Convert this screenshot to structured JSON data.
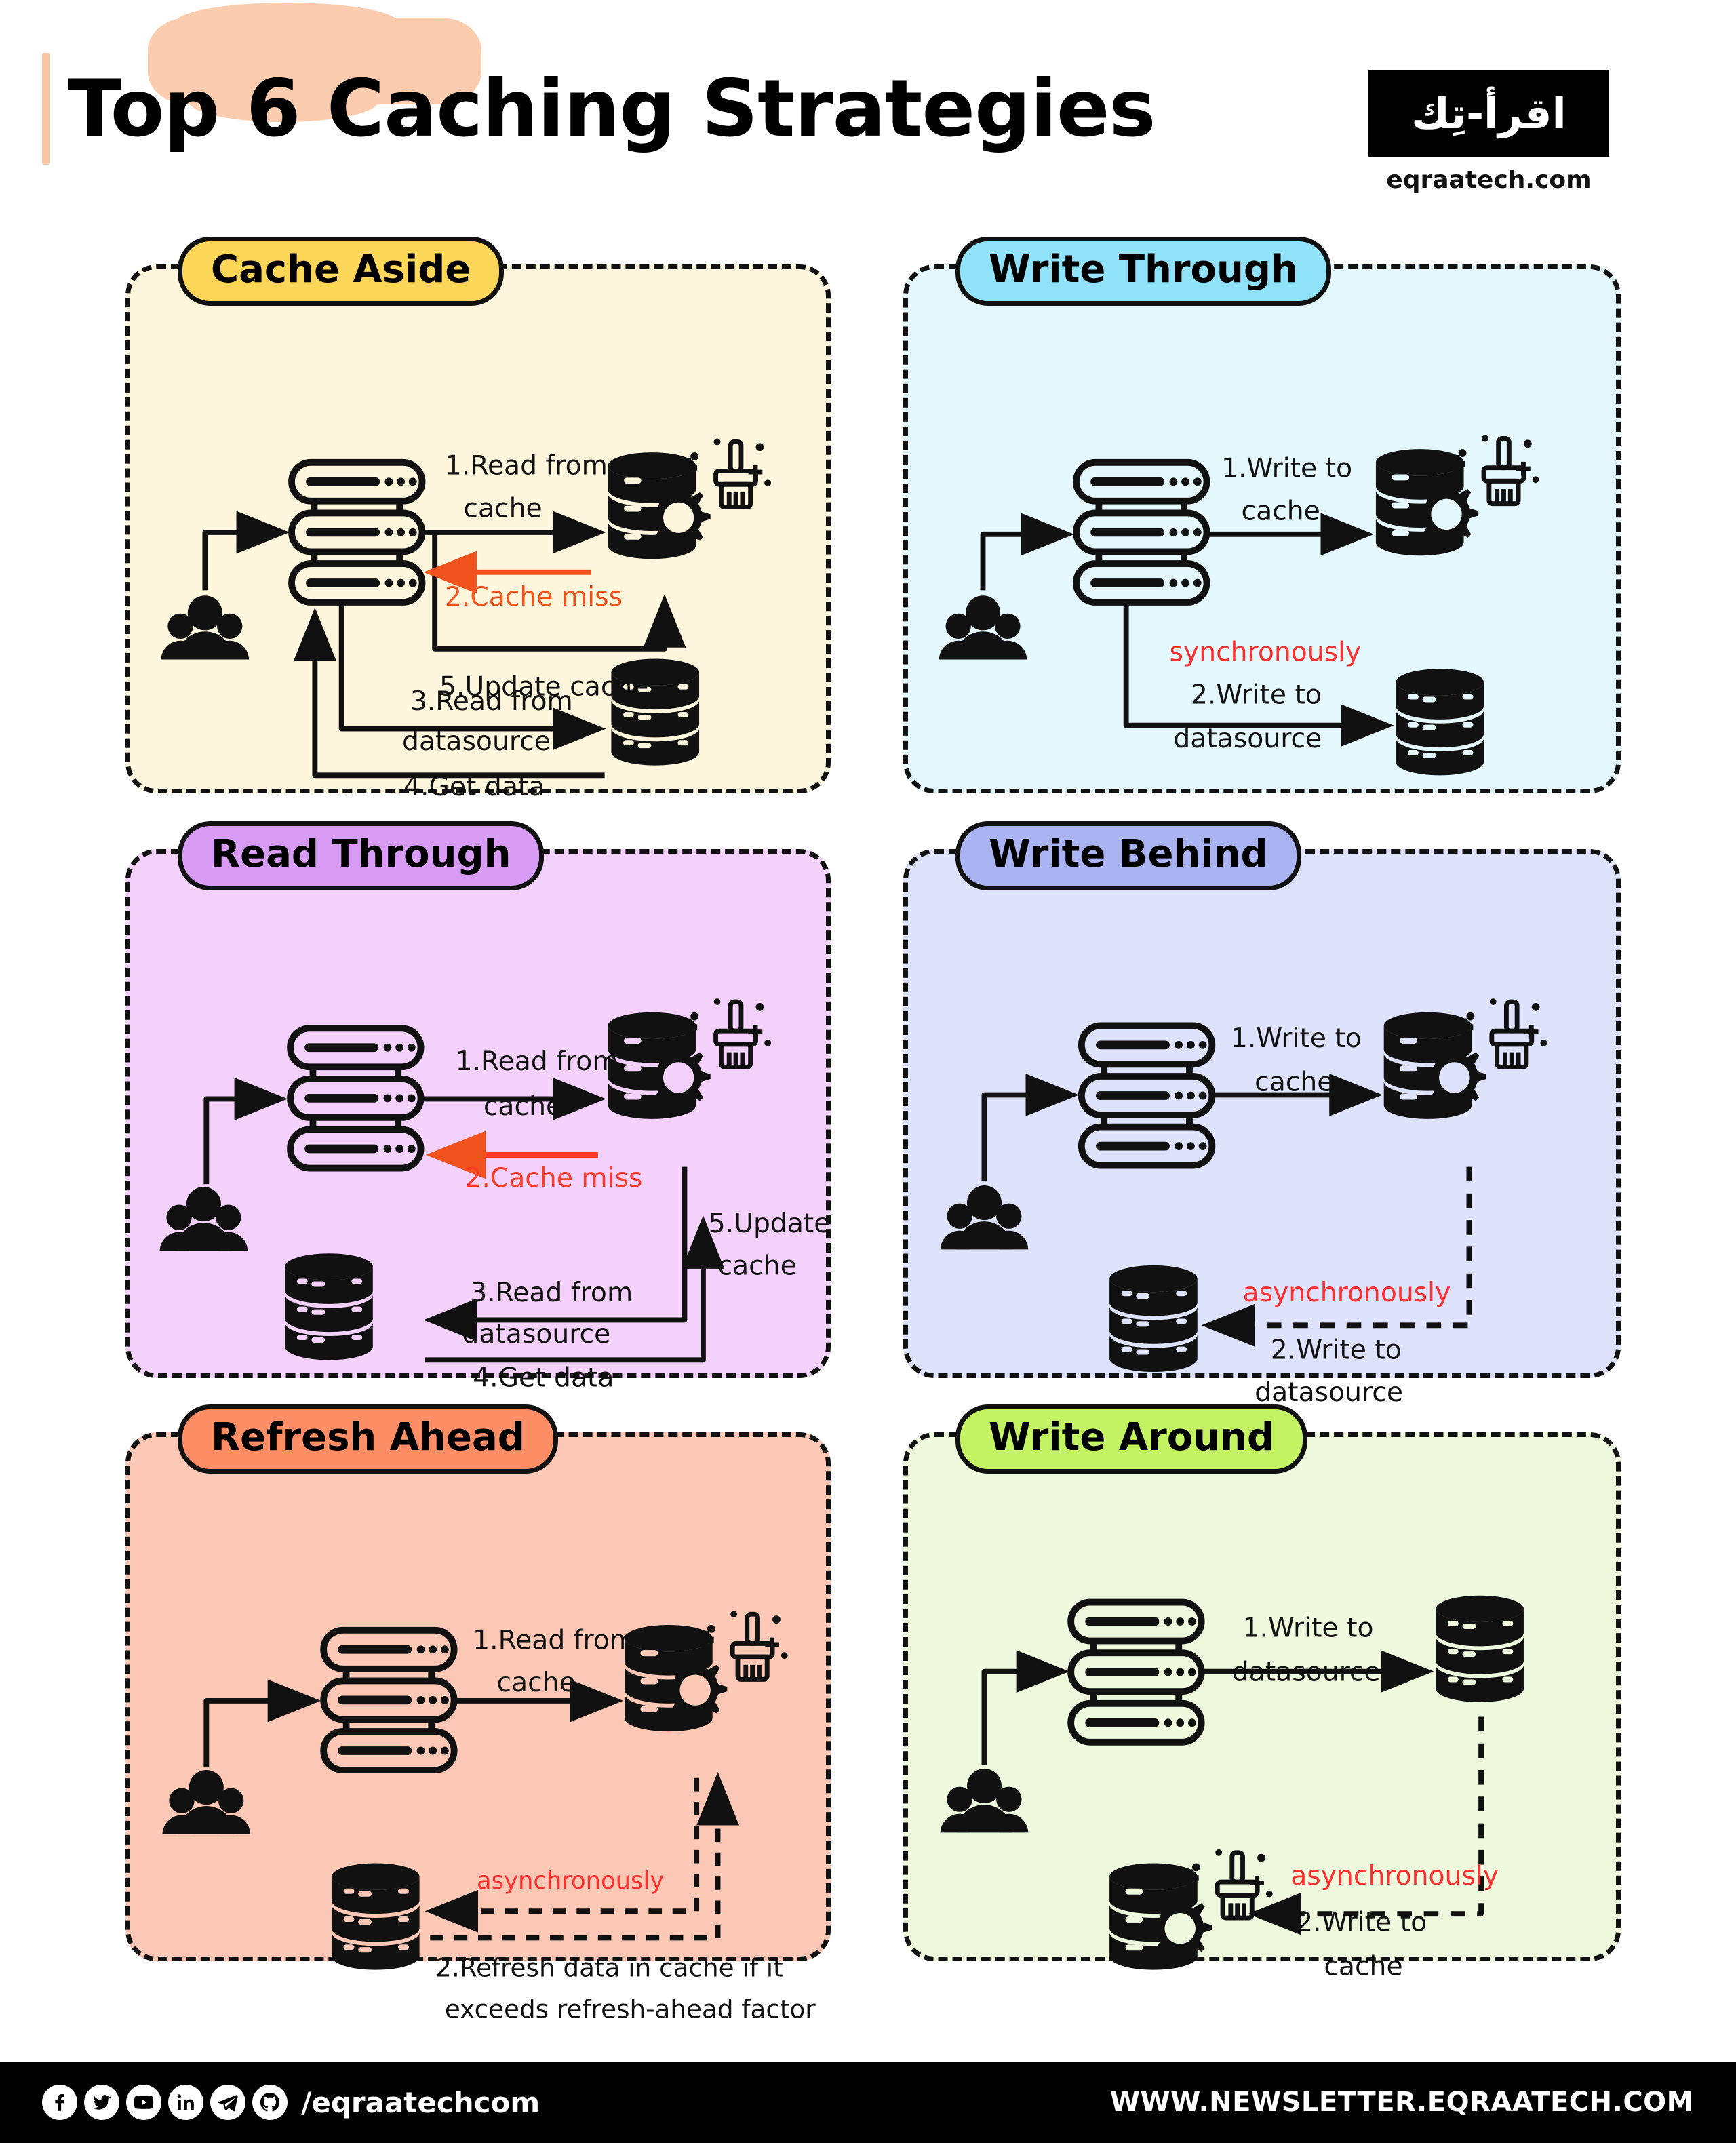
{
  "header": {
    "title_prefix": "Top ",
    "title_highlight": "6 Caching",
    "title_suffix": " Strategies",
    "title_full": "Top 6 Caching Strategies",
    "logo_arabic": "اقرأ-تِك",
    "logo_site": "eqraatech.com",
    "highlight_color": "#fbcdae"
  },
  "panels": [
    {
      "id": "cache-aside",
      "title": "Cache Aside",
      "badge_color": "#fcd659",
      "bg_color": "#fdf6dd",
      "steps": [
        {
          "n": "1.",
          "text": "1.Read from",
          "text2": "cache",
          "color": "#111111"
        },
        {
          "n": "2.",
          "text": "2.Cache miss",
          "color": "#f0521e"
        },
        {
          "n": "5.",
          "text": "5.Update cache",
          "color": "#111111"
        },
        {
          "n": "3.",
          "text": "3.Read from",
          "text2": "datasource",
          "color": "#111111"
        },
        {
          "n": "4.",
          "text": "4.Get data",
          "color": "#111111"
        }
      ],
      "nodes": [
        "users-icon",
        "server-icon",
        "cache-db-icon",
        "datasource-db-icon"
      ]
    },
    {
      "id": "write-through",
      "title": "Write Through",
      "badge_color": "#8fe2f7",
      "bg_color": "#e4f7fd",
      "steps": [
        {
          "n": "1.",
          "text": "1.Write to",
          "text2": "cache",
          "color": "#111111"
        },
        {
          "n": "",
          "text": "synchronously",
          "color": "#fd2f2f"
        },
        {
          "n": "2.",
          "text": "2.Write to",
          "text2": "datasource",
          "color": "#111111"
        }
      ],
      "nodes": [
        "users-icon",
        "server-icon",
        "cache-db-icon",
        "datasource-db-icon"
      ]
    },
    {
      "id": "read-through",
      "title": "Read Through",
      "badge_color": "#d99cf5",
      "bg_color": "#f3d1fb",
      "steps": [
        {
          "n": "1.",
          "text": "1.Read from",
          "text2": "cache",
          "color": "#111111"
        },
        {
          "n": "2.",
          "text": "2.Cache miss",
          "color": "#fd3b28"
        },
        {
          "n": "5.",
          "text": "5.Update",
          "text2": "cache",
          "color": "#111111"
        },
        {
          "n": "3.",
          "text": "3.Read from",
          "text2": "datasource",
          "color": "#111111"
        },
        {
          "n": "4.",
          "text": "4.Get data",
          "color": "#111111"
        }
      ],
      "nodes": [
        "users-icon",
        "server-icon",
        "cache-db-icon",
        "datasource-db-icon"
      ]
    },
    {
      "id": "write-behind",
      "title": "Write Behind",
      "badge_color": "#aab4f3",
      "bg_color": "#dfe2fb",
      "steps": [
        {
          "n": "1.",
          "text": "1.Write to",
          "text2": "cache",
          "color": "#111111"
        },
        {
          "n": "",
          "text": "asynchronously",
          "color": "#fd2f2f"
        },
        {
          "n": "2.",
          "text": "2.Write to",
          "text2": "datasource",
          "color": "#111111"
        }
      ],
      "nodes": [
        "users-icon",
        "server-icon",
        "cache-db-icon",
        "datasource-db-icon"
      ]
    },
    {
      "id": "refresh-ahead",
      "title": "Refresh Ahead",
      "badge_color": "#fc8d64",
      "bg_color": "#fcc8b6",
      "steps": [
        {
          "n": "1.",
          "text": "1.Read from",
          "text2": "cache",
          "color": "#111111"
        },
        {
          "n": "",
          "text": "asynchronously",
          "color": "#fd2f2f"
        },
        {
          "n": "2.",
          "text": "2.Refresh data in cache if it",
          "text2": "exceeds refresh-ahead factor",
          "color": "#111111"
        }
      ],
      "nodes": [
        "users-icon",
        "server-icon",
        "cache-db-icon",
        "datasource-db-icon"
      ]
    },
    {
      "id": "write-around",
      "title": "Write Around",
      "badge_color": "#c3f263",
      "bg_color": "#eef8dd",
      "steps": [
        {
          "n": "1.",
          "text": "1.Write to",
          "text2": "datasource",
          "color": "#111111"
        },
        {
          "n": "",
          "text": "asynchronously",
          "color": "#fd2f2f"
        },
        {
          "n": "2.",
          "text": "2.Write to",
          "text2": "cache",
          "color": "#111111"
        }
      ],
      "nodes": [
        "users-icon",
        "server-icon",
        "cache-db-icon",
        "datasource-db-icon"
      ]
    }
  ],
  "footer": {
    "handle": "/eqraatechcom",
    "website": "WWW.NEWSLETTER.EQRAATECH.COM",
    "social": [
      {
        "name": "facebook-icon",
        "glyph": "f"
      },
      {
        "name": "twitter-icon",
        "glyph": "t"
      },
      {
        "name": "youtube-icon",
        "glyph": "▶"
      },
      {
        "name": "linkedin-icon",
        "glyph": "in"
      },
      {
        "name": "telegram-icon",
        "glyph": "➤"
      },
      {
        "name": "github-icon",
        "glyph": "G"
      }
    ]
  }
}
